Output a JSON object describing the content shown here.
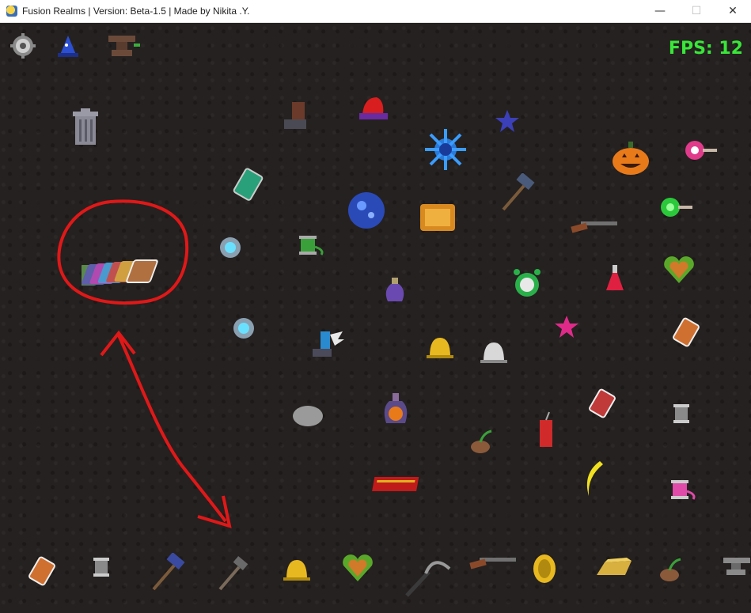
{
  "window": {
    "title": "Fusion Realms | Version: Beta-1.5 | Made by Nikita .Y.",
    "minimize": "—",
    "maximize": "☐",
    "close": "✕"
  },
  "hud": {
    "fps_text": "FPS: 12"
  },
  "colors": {
    "fps": "#39e639",
    "annotation": "#e01818",
    "background": "#252120"
  }
}
